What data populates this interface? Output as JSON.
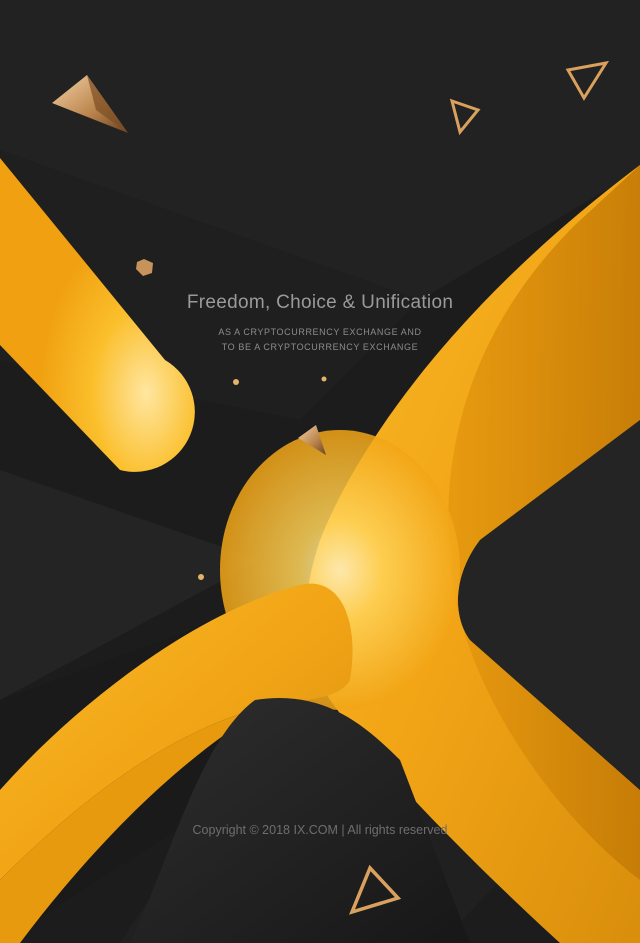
{
  "headline": {
    "title": "Freedom, Choice & Unification",
    "subtitle_line1": "AS A CRYPTOCURRENCY EXCHANGE AND",
    "subtitle_line2": "TO BE A CRYPTOCURRENCY EXCHANGE"
  },
  "footer": {
    "copyright": "Copyright © 2018 IX.COM | All rights reserved"
  },
  "colors": {
    "background": "#1c1c1c",
    "gold": "#f2a516",
    "gold_light": "#ffe7a0",
    "gold_dark": "#c77f08",
    "text_gray": "#9a9a9a"
  },
  "decorations": [
    "outline-triangle-icon",
    "solid-pyramid-icon",
    "gem-icon",
    "dot-icon"
  ]
}
